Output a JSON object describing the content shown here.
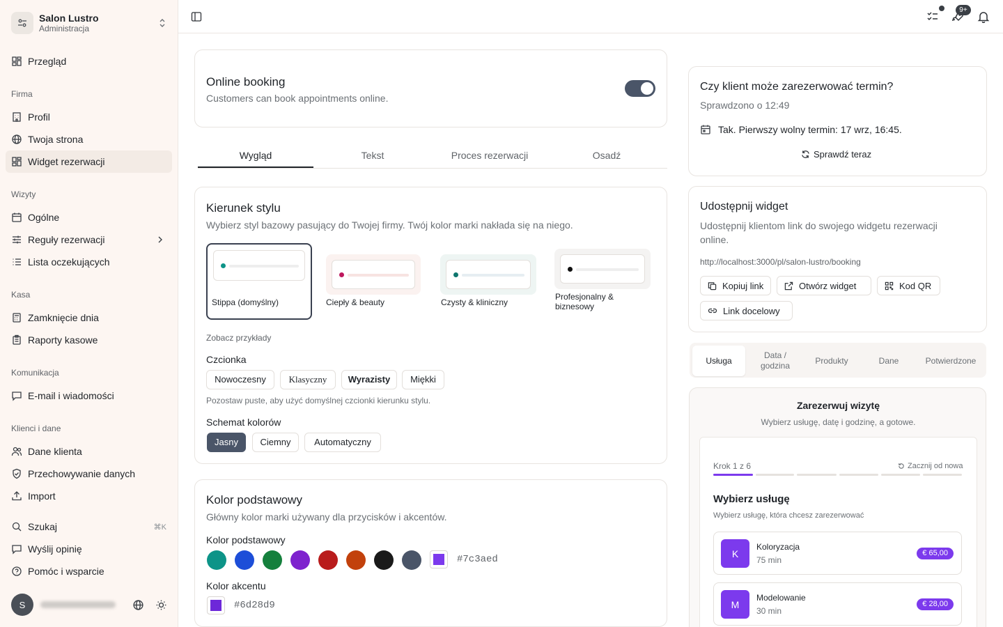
{
  "brand": {
    "name": "Salon Lustro",
    "subtitle": "Administracja"
  },
  "nav": {
    "overview": "Przegląd",
    "sections": {
      "firma": "Firma",
      "wizyty": "Wizyty",
      "kasa": "Kasa",
      "komunikacja": "Komunikacja",
      "klienci": "Klienci i dane"
    },
    "profil": "Profil",
    "twoja_strona": "Twoja strona",
    "widget": "Widget rezerwacji",
    "ogolne": "Ogólne",
    "reguly": "Reguły rezerwacji",
    "lista": "Lista oczekujących",
    "zamkniecie": "Zamknięcie dnia",
    "raporty": "Raporty kasowe",
    "email": "E-mail i wiadomości",
    "dane_klienta": "Dane klienta",
    "przechowywanie": "Przechowywanie danych",
    "import": "Import",
    "szukaj": "Szukaj",
    "shortcut": "⌘K",
    "opinia": "Wyślij opinię",
    "pomoc": "Pomóc i wsparcie",
    "user_initial": "S"
  },
  "topbar": {
    "badge": "9+"
  },
  "booking": {
    "title": "Online booking",
    "subtitle": "Customers can book appointments online.",
    "enabled": true
  },
  "tabs": [
    "Wygląd",
    "Tekst",
    "Proces rezerwacji",
    "Osadź"
  ],
  "style": {
    "title": "Kierunek stylu",
    "subtitle": "Wybierz styl bazowy pasujący do Twojej firmy. Twój kolor marki nakłada się na niego.",
    "options": [
      {
        "label": "Stippa (domyślny)",
        "dot": "#0d9488",
        "line": "#eeeeee"
      },
      {
        "label": "Ciepły & beauty",
        "dot": "#be185d",
        "line": "#f7e3e1"
      },
      {
        "label": "Czysty & kliniczny",
        "dot": "#0f766e",
        "line": "#e6eef2"
      },
      {
        "label": "Profesjonalny & biznesowy",
        "dot": "#111111",
        "line": "#eeeeee"
      }
    ],
    "examples": "Zobacz przykłady",
    "font_title": "Czcionka",
    "fonts": [
      "Nowoczesny",
      "Klasyczny",
      "Wyrazisty",
      "Miękki"
    ],
    "font_hint": "Pozostaw puste, aby użyć domyślnej czcionki kierunku stylu.",
    "scheme_title": "Schemat kolorów",
    "schemes": [
      "Jasny",
      "Ciemny",
      "Automatyczny"
    ]
  },
  "colors": {
    "title": "Kolor podstawowy",
    "subtitle": "Główny kolor marki używany dla przycisków i akcentów.",
    "primary_label": "Kolor podstawowy",
    "swatches": [
      "#0d9488",
      "#1d4ed8",
      "#15803d",
      "#7e22ce",
      "#b91c1c",
      "#c2410c",
      "#1a1a1a",
      "#4a5568"
    ],
    "primary_value": "#7c3aed",
    "accent_label": "Kolor akcentu",
    "accent_value": "#6d28d9"
  },
  "check": {
    "title": "Czy klient może zarezerwować termin?",
    "checked": "Sprawdzono o 12:49",
    "result": "Tak. Pierwszy wolny termin: 17 wrz, 16:45.",
    "button": "Sprawdź teraz"
  },
  "share": {
    "title": "Udostępnij widget",
    "subtitle": "Udostępnij klientom link do swojego widgetu rezerwacji online.",
    "url": "http://localhost:3000/pl/salon-lustro/booking",
    "copy": "Kopiuj link",
    "open": "Otwórz widget",
    "qr": "Kod QR",
    "target": "Link docelowy"
  },
  "preview_tabs": [
    "Usługa",
    "Data / godzina",
    "Produkty",
    "Dane",
    "Potwierdzone"
  ],
  "widget": {
    "title": "Zarezerwuj wizytę",
    "subtitle": "Wybierz usługę, datę i godzinę, a gotowe.",
    "step": "Krok 1 z 6",
    "restart": "Zacznij od nowa",
    "heading": "Wybierz usługę",
    "hint": "Wybierz usługę, która chcesz zarezerwować",
    "accent": "#7c3aed",
    "services": [
      {
        "initial": "K",
        "name": "Koloryzacja",
        "duration": "75 min",
        "price": "€ 65,00"
      },
      {
        "initial": "M",
        "name": "Modelowanie",
        "duration": "30 min",
        "price": "€ 28,00"
      }
    ]
  }
}
